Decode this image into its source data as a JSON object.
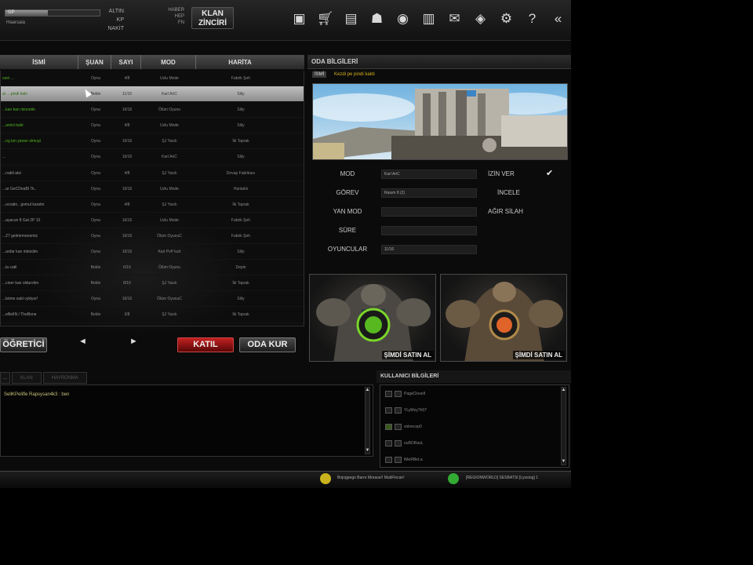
{
  "topbar": {
    "xp_label": "GP",
    "xp_fraction": 0.45,
    "nickname": "Haarsaia",
    "stats": [
      "ALTIN",
      "KP",
      "NAKİT"
    ],
    "stats2": [
      "HABER",
      "HEP",
      "FN"
    ],
    "klan_line1": "KLAN",
    "klan_line2": "ZİNCİRİ",
    "icons": [
      "screenshot-icon",
      "cart-icon",
      "save-icon",
      "wolf-icon",
      "fire-icon",
      "gift-icon",
      "mail-icon",
      "cards-icon",
      "gear-icon",
      "help-icon",
      "back-icon"
    ]
  },
  "room_list": {
    "columns": [
      "İSMİ",
      "ŞUAN",
      "SAYI",
      "MOD",
      "HARİTA"
    ],
    "rows": [
      {
        "name": "ozel ...",
        "status": "Oyna",
        "count": "4/8",
        "mode": "Uzlu Mode",
        "map": "Fabrik Şeh",
        "green": true
      },
      {
        "name": "al ....pindi kaki",
        "status": "Bekle",
        "count": "11/16",
        "mode": "Karl AriC",
        "map": "Siliy",
        "green": true,
        "selected": true
      },
      {
        "name": "...kan kan minnetle",
        "status": "Oyna",
        "count": "16/16",
        "mode": "Ölüm Oyunu",
        "map": "Siliy",
        "green": true
      },
      {
        "name": "...amisi bakt",
        "status": "Oyna",
        "count": "4/8",
        "mode": "Uzlu Mode",
        "map": "Siliy",
        "green": true
      },
      {
        "name": "...ng lan yanan olmuşt",
        "status": "Oyna",
        "count": "16/16",
        "mode": "ŞJ Yazılı",
        "map": "İki Taprak",
        "green": true
      },
      {
        "name": "...",
        "status": "Oyna",
        "count": "16/16",
        "mode": "Karl AriC",
        "map": "Siliy",
        "green": false
      },
      {
        "name": "...nabil atsi",
        "status": "Oyna",
        "count": "4/8",
        "mode": "ŞJ Yazılı",
        "map": "Devap Fabrikası",
        "green": false
      },
      {
        "name": "...ar GeCDeaBl 7k..",
        "status": "Oyna",
        "count": "16/16",
        "mode": "Uzlu Mode",
        "map": "Hantalık",
        "green": false
      },
      {
        "name": "...ocratin.. gomul karatin",
        "status": "Oyna",
        "count": "4/8",
        "mode": "ŞJ Yazılı",
        "map": "İki Taprak",
        "green": false
      },
      {
        "name": "...ayacun 8 Gat 2P 10",
        "status": "Oyna",
        "count": "16/16",
        "mode": "Uzlu Mode",
        "map": "Fabrik Şeh",
        "green": false
      },
      {
        "name": "...27 gelmirmenemiz",
        "status": "Oyna",
        "count": "16/16",
        "mode": "Ölüm OyunuC",
        "map": "Fabrik Şeh",
        "green": false
      },
      {
        "name": "...ardar kan inbüslim",
        "status": "Oyna",
        "count": "16/16",
        "mode": "Karl PvP kurt",
        "map": "Siliy",
        "green": false
      },
      {
        "name": "...la catil",
        "status": "Bekle",
        "count": "6/16",
        "mode": "Ölüm Oyunu",
        "map": "Depin",
        "green": false
      },
      {
        "name": "...ciner kan oldurelim",
        "status": "Bekle",
        "count": "8/16",
        "mode": "ŞJ Yazılı",
        "map": "İki Taprak",
        "green": false
      },
      {
        "name": "...letme sakt cykiyor!",
        "status": "Oyna",
        "count": "16/16",
        "mode": "Ölüm OyunuC",
        "map": "Siliy",
        "green": false
      },
      {
        "name": "...eBelIN / TheBone",
        "status": "Bekle",
        "count": "3/8",
        "mode": "ŞJ Yazılı",
        "map": "İki Taprak",
        "green": false
      }
    ]
  },
  "buttons": {
    "ogretici": "ÖĞRETİCİ",
    "prev": "◄",
    "next": "►",
    "katil": "KATIL",
    "oda_kur": "ODA KUR"
  },
  "room_info": {
    "title": "ODA BİLGİLERİ",
    "name_label": "İSMİ",
    "name_value": "Kezdi pe pindi kakti",
    "details": [
      {
        "label": "MOD",
        "value": "Karl AriC"
      },
      {
        "label": "GÖREV",
        "value": "Rasım 8 (2)"
      },
      {
        "label": "YAN MOD",
        "value": ""
      },
      {
        "label": "SÜRE",
        "value": ""
      },
      {
        "label": "OYUNCULAR",
        "value": "11/16"
      }
    ],
    "options": [
      "İZİN VER",
      "İNCELE",
      "AĞIR SİLAH"
    ],
    "promo_label": "ŞİMDİ SATIN AL"
  },
  "chat": {
    "tabs": [
      "...",
      "KLAN",
      "HAYRONMA"
    ],
    "message": "SellKPelifle  Rapsysan4k3 : ben"
  },
  "users": {
    "title": "KULLANICI BİLGİLERİ",
    "list": [
      "PageClose8",
      "YLyMoy7h07",
      "solnecop0",
      "ouRDRaoL",
      "tMeRBeLa"
    ]
  },
  "status": {
    "left": "Bojogpego Barre Morasa!! MutiFincan!",
    "right": "[REGIONWORLD] SESBATSI [Lyosiog] 1"
  },
  "colors": {
    "accent_red": "#c32020",
    "green_room": "#4fb41e",
    "gold": "#d4b21c"
  }
}
